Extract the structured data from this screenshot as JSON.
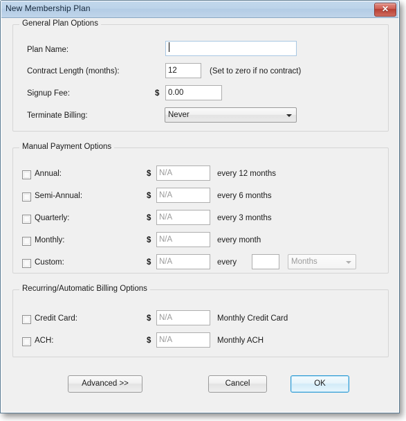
{
  "window": {
    "title": "New Membership Plan",
    "close_label": "✕",
    "close_icon": "close-icon",
    "accent_border": "#5c7c93",
    "titlebar_color": "#bcd3e9",
    "body_color": "#f0f0f0"
  },
  "general": {
    "legend": "General Plan Options",
    "plan_name": {
      "label": "Plan Name:",
      "value": "",
      "placeholder": "",
      "focused": true
    },
    "contract_length": {
      "label": "Contract Length (months):",
      "value": "12",
      "hint": "(Set to zero if no contract)"
    },
    "signup_fee": {
      "label": "Signup Fee:",
      "currency": "$",
      "value": "0.00"
    },
    "terminate_billing": {
      "label": "Terminate Billing:",
      "value": "Never"
    }
  },
  "manual": {
    "legend": "Manual Payment Options",
    "currency": "$",
    "rows": [
      {
        "label": "Annual:",
        "checked": false,
        "amount": "N/A",
        "suffix": "every  12 months"
      },
      {
        "label": "Semi-Annual:",
        "checked": false,
        "amount": "N/A",
        "suffix": "every 6 months"
      },
      {
        "label": "Quarterly:",
        "checked": false,
        "amount": "N/A",
        "suffix": "every 3 months"
      },
      {
        "label": "Monthly:",
        "checked": false,
        "amount": "N/A",
        "suffix": "every month"
      }
    ],
    "custom": {
      "label": "Custom:",
      "checked": false,
      "amount": "N/A",
      "suffix": "every",
      "interval_value": "",
      "unit_value": "Months",
      "unit_disabled": true
    }
  },
  "recurring": {
    "legend": "Recurring/Automatic Billing Options",
    "currency": "$",
    "rows": [
      {
        "label": "Credit Card:",
        "checked": false,
        "amount": "N/A",
        "suffix": "Monthly Credit Card"
      },
      {
        "label": "ACH:",
        "checked": false,
        "amount": "N/A",
        "suffix": "Monthly ACH"
      }
    ]
  },
  "footer": {
    "advanced_label": "Advanced >>",
    "cancel_label": "Cancel",
    "ok_label": "OK"
  }
}
